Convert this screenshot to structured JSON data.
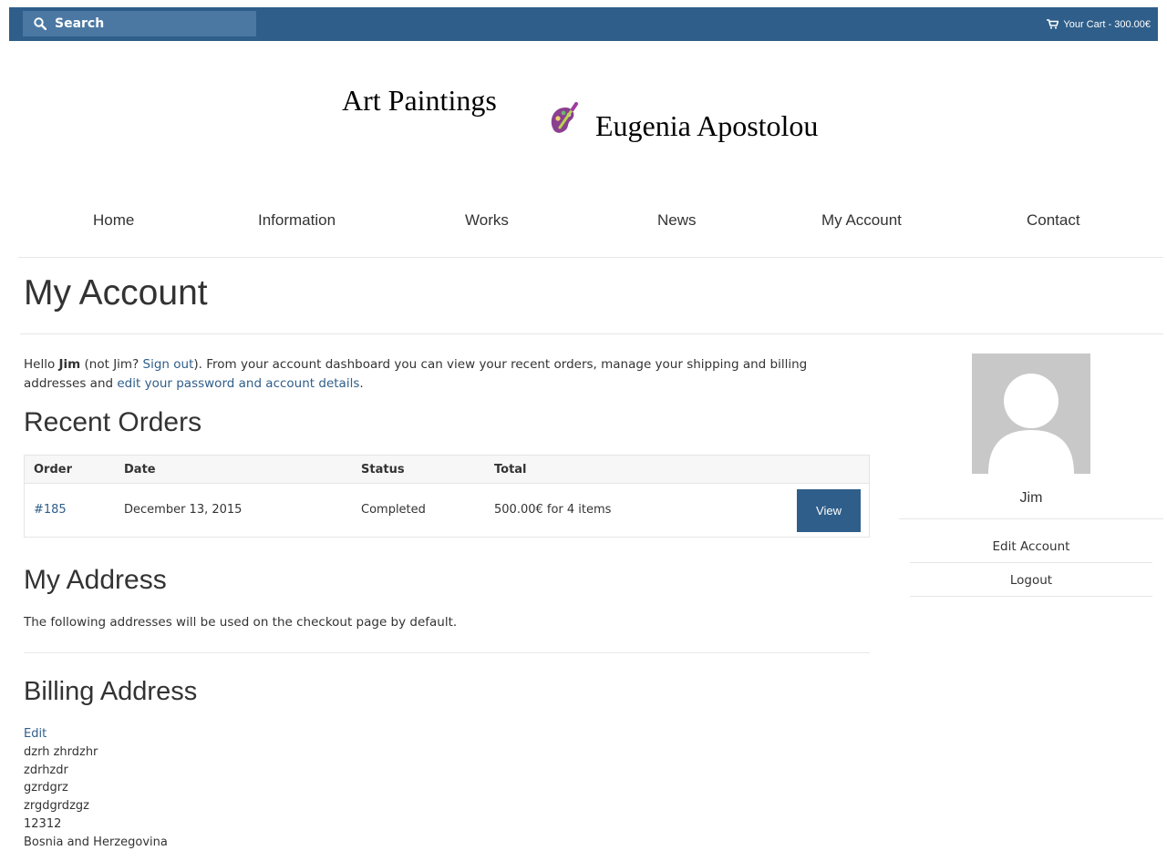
{
  "topbar": {
    "search_label": "Search",
    "cart_label": "Your Cart - 300.00€",
    "bg_color": "#2f5e8a"
  },
  "logo": {
    "left_text": "Art Paintings",
    "right_text": "Eugenia Apostolou"
  },
  "nav": {
    "items": [
      {
        "label": "Home"
      },
      {
        "label": "Information"
      },
      {
        "label": "Works"
      },
      {
        "label": "News"
      },
      {
        "label": "My Account"
      },
      {
        "label": "Contact"
      }
    ]
  },
  "page": {
    "title": "My Account"
  },
  "intro": {
    "hello": "Hello",
    "user": "Jim",
    "not_prefix": "(not Jim?",
    "sign_out": "Sign out",
    "middle": "). From your account dashboard you can view your recent orders, manage your shipping and billing addresses and",
    "edit_link": "edit your password and account details",
    "end": "."
  },
  "orders": {
    "heading": "Recent Orders",
    "columns": [
      "Order",
      "Date",
      "Status",
      "Total"
    ],
    "rows": [
      {
        "order": "#185",
        "date": "December 13, 2015",
        "status": "Completed",
        "total": "500.00€ for 4 items",
        "action": "View"
      }
    ]
  },
  "address": {
    "heading": "My Address",
    "description": "The following addresses will be used on the checkout page by default.",
    "billing_heading": "Billing Address",
    "edit_label": "Edit",
    "lines": [
      "dzrh zhrdzhr",
      "zdrhzdr",
      "gzrdgrz",
      "zrgdgrdzgz",
      "12312",
      "Bosnia and Herzegovina"
    ]
  },
  "sidebar": {
    "username": "Jim",
    "links": [
      {
        "label": "Edit Account"
      },
      {
        "label": "Logout"
      }
    ]
  },
  "colors": {
    "accent": "#2f5e8a",
    "link": "#2f5e8a",
    "avatar_bg": "#c8c8c8"
  }
}
